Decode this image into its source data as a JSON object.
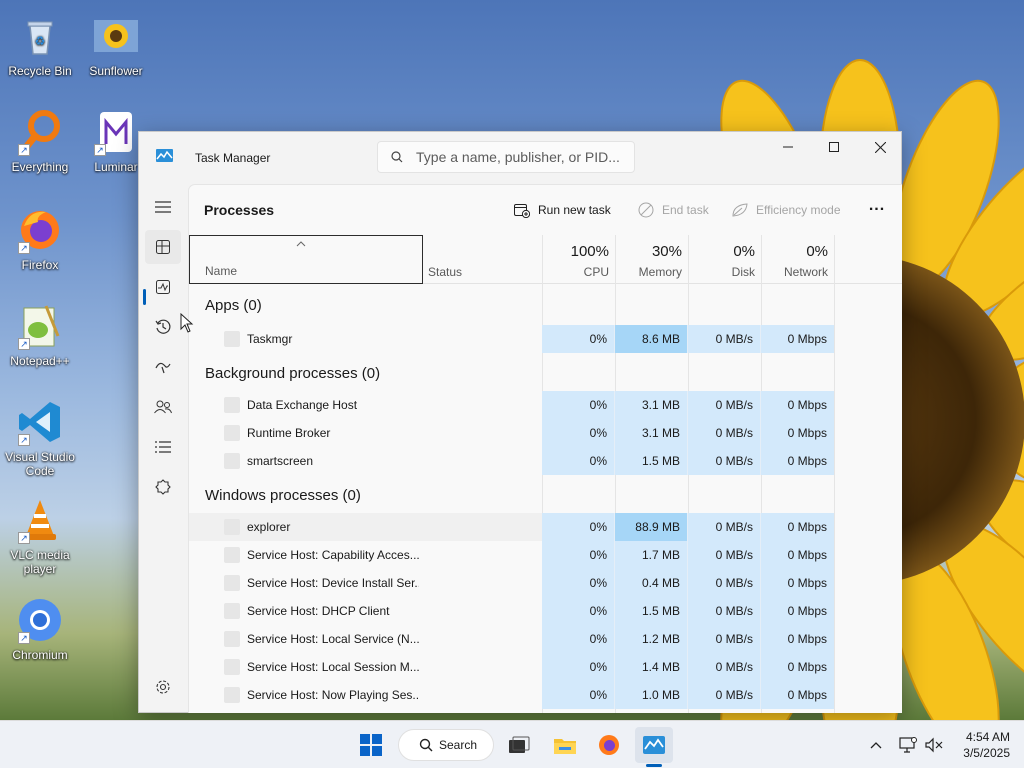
{
  "desktop": {
    "icons": [
      {
        "label": "Recycle Bin",
        "icon": "recycle-bin-icon"
      },
      {
        "label": "Sunflower",
        "icon": "sunflower-image-icon"
      },
      {
        "label": "Everything",
        "icon": "everything-search-icon"
      },
      {
        "label": "Luminar",
        "icon": "luminar-icon"
      },
      {
        "label": "Firefox",
        "icon": "firefox-icon"
      },
      {
        "label": "Notepad++",
        "icon": "notepadpp-icon"
      },
      {
        "label": "Visual Studio Code",
        "icon": "vscode-icon"
      },
      {
        "label": "VLC media player",
        "icon": "vlc-icon"
      },
      {
        "label": "Chromium",
        "icon": "chromium-icon"
      }
    ]
  },
  "window": {
    "title": "Task Manager",
    "search_placeholder": "Type a name, publisher, or PID..."
  },
  "nav": {
    "items": [
      "hamburger-menu-icon",
      "processes-icon",
      "performance-icon",
      "app-history-icon",
      "startup-apps-icon",
      "users-icon",
      "details-icon",
      "services-icon",
      "settings-icon"
    ],
    "active": "processes"
  },
  "toolbar": {
    "page_title": "Processes",
    "run_new_task": "Run new task",
    "end_task": "End task",
    "efficiency_mode": "Efficiency mode",
    "more": "..."
  },
  "columns": {
    "name": "Name",
    "status": "Status",
    "cpu": {
      "pct": "100%",
      "label": "CPU"
    },
    "memory": {
      "pct": "30%",
      "label": "Memory"
    },
    "disk": {
      "pct": "0%",
      "label": "Disk"
    },
    "network": {
      "pct": "0%",
      "label": "Network"
    }
  },
  "groups": [
    {
      "label": "Apps (0)",
      "rows": [
        {
          "name": "Taskmgr",
          "cpu": "0%",
          "memory": "8.6 MB",
          "disk": "0 MB/s",
          "network": "0 Mbps",
          "mem_high": true
        }
      ]
    },
    {
      "label": "Background processes (0)",
      "rows": [
        {
          "name": "Data Exchange Host",
          "cpu": "0%",
          "memory": "3.1 MB",
          "disk": "0 MB/s",
          "network": "0 Mbps"
        },
        {
          "name": "Runtime Broker",
          "cpu": "0%",
          "memory": "3.1 MB",
          "disk": "0 MB/s",
          "network": "0 Mbps"
        },
        {
          "name": "smartscreen",
          "cpu": "0%",
          "memory": "1.5 MB",
          "disk": "0 MB/s",
          "network": "0 Mbps"
        }
      ]
    },
    {
      "label": "Windows processes (0)",
      "rows": [
        {
          "name": "explorer",
          "cpu": "0%",
          "memory": "88.9 MB",
          "disk": "0 MB/s",
          "network": "0 Mbps",
          "mem_high": true,
          "hover": true
        },
        {
          "name": "Service Host: Capability Acces...",
          "cpu": "0%",
          "memory": "1.7 MB",
          "disk": "0 MB/s",
          "network": "0 Mbps"
        },
        {
          "name": "Service Host: Device Install Ser...",
          "cpu": "0%",
          "memory": "0.4 MB",
          "disk": "0 MB/s",
          "network": "0 Mbps"
        },
        {
          "name": "Service Host: DHCP Client",
          "cpu": "0%",
          "memory": "1.5 MB",
          "disk": "0 MB/s",
          "network": "0 Mbps"
        },
        {
          "name": "Service Host: Local Service (N...",
          "cpu": "0%",
          "memory": "1.2 MB",
          "disk": "0 MB/s",
          "network": "0 Mbps"
        },
        {
          "name": "Service Host: Local Session M...",
          "cpu": "0%",
          "memory": "1.4 MB",
          "disk": "0 MB/s",
          "network": "0 Mbps"
        },
        {
          "name": "Service Host: Now Playing Ses...",
          "cpu": "0%",
          "memory": "1.0 MB",
          "disk": "0 MB/s",
          "network": "0 Mbps"
        }
      ]
    }
  ],
  "taskbar": {
    "search_label": "Search",
    "time": "4:54 AM",
    "date": "3/5/2025"
  },
  "colors": {
    "accent": "#005fb8",
    "heat_low": "#d3e9fb",
    "heat_high": "#a6d6f7"
  }
}
